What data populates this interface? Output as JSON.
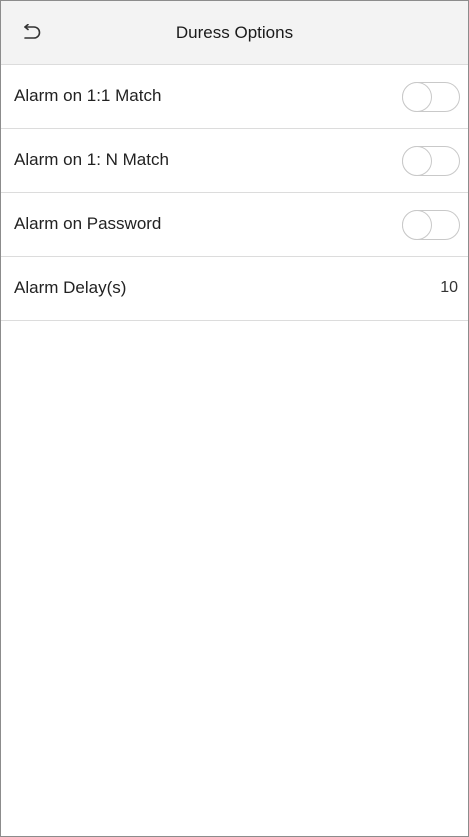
{
  "header": {
    "back_icon": "back-arrow-icon",
    "title": "Duress Options"
  },
  "settings": [
    {
      "label": "Alarm on 1:1 Match",
      "type": "toggle",
      "enabled": false
    },
    {
      "label": "Alarm on 1: N Match",
      "type": "toggle",
      "enabled": false
    },
    {
      "label": "Alarm on Password",
      "type": "toggle",
      "enabled": false
    },
    {
      "label": "Alarm Delay(s)",
      "type": "value",
      "value": "10"
    }
  ],
  "colors": {
    "header_bg": "#f3f3f3",
    "divider": "#dcdcdc",
    "toggle_border": "#c9c9c9",
    "frame_border": "#8c8c8c"
  }
}
